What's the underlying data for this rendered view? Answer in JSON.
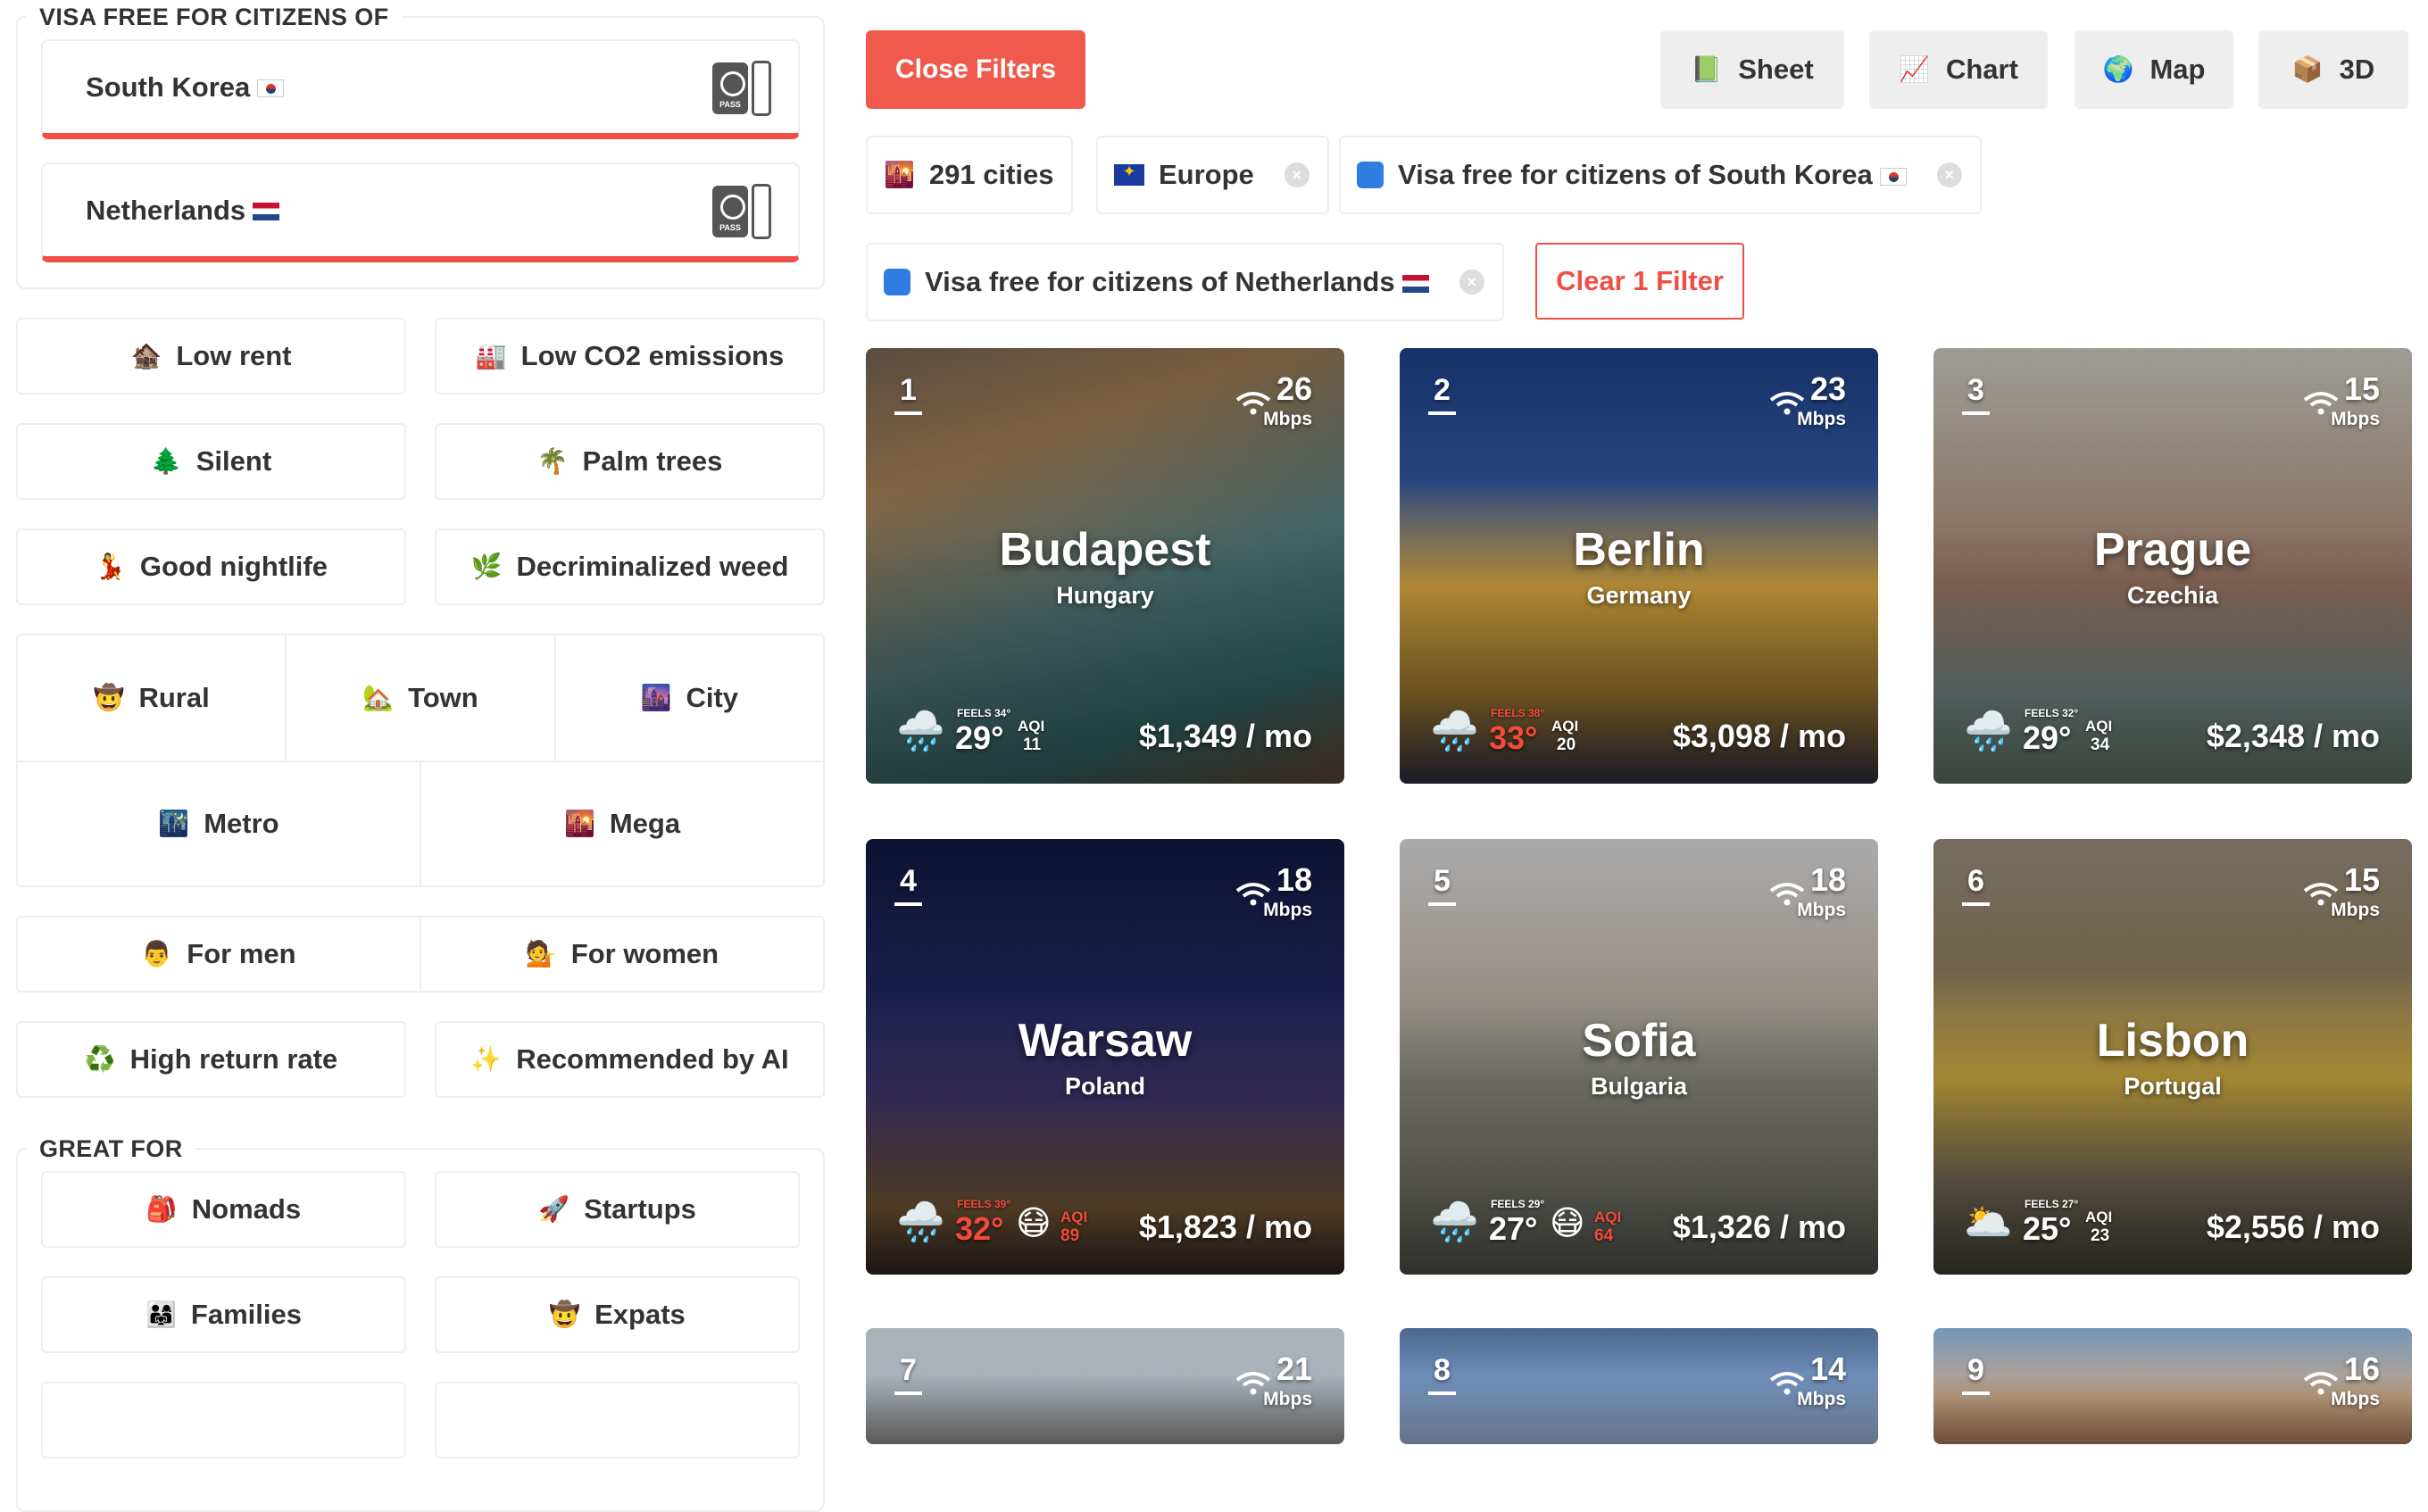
{
  "sidebar": {
    "visa_legend": "VISA FREE FOR CITIZENS OF",
    "visa_countries": [
      {
        "label": "South Korea"
      },
      {
        "label": "Netherlands"
      }
    ],
    "pass_text": "PASS",
    "filters_a": [
      {
        "icon": "🏚️",
        "label": "Low rent"
      },
      {
        "icon": "🏭",
        "label": "Low CO2 emissions"
      },
      {
        "icon": "🌲",
        "label": "Silent"
      },
      {
        "icon": "🌴",
        "label": "Palm trees"
      },
      {
        "icon": "💃",
        "label": "Good nightlife"
      },
      {
        "icon": "🌿",
        "label": "Decriminalized weed"
      }
    ],
    "sizes": [
      {
        "icon": "🤠",
        "label": "Rural"
      },
      {
        "icon": "🏡",
        "label": "Town"
      },
      {
        "icon": "🌆",
        "label": "City"
      },
      {
        "icon": "🌃",
        "label": "Metro"
      },
      {
        "icon": "🌇",
        "label": "Mega"
      }
    ],
    "gender": [
      {
        "icon": "👨",
        "label": "For men"
      },
      {
        "icon": "💁",
        "label": "For women"
      }
    ],
    "filters_b": [
      {
        "icon": "♻️",
        "label": "High return rate"
      },
      {
        "icon": "✨",
        "label": "Recommended by AI"
      }
    ],
    "great_for_legend": "GREAT FOR",
    "great_for": [
      {
        "icon": "🎒",
        "label": "Nomads"
      },
      {
        "icon": "🚀",
        "label": "Startups"
      },
      {
        "icon": "👨‍👩‍👧",
        "label": "Families"
      },
      {
        "icon": "🤠",
        "label": "Expats"
      }
    ]
  },
  "toolbar": {
    "close_filters": "Close Filters",
    "views": [
      {
        "icon": "📗",
        "label": "Sheet"
      },
      {
        "icon": "📈",
        "label": "Chart"
      },
      {
        "icon": "🌍",
        "label": "Map"
      },
      {
        "icon": "📦",
        "label": "3D"
      }
    ]
  },
  "chips": {
    "cities": {
      "icon": "🌇",
      "label": "291 cities"
    },
    "region": {
      "label": "Europe"
    },
    "visa_kr": {
      "label": "Visa free for citizens of South Korea"
    },
    "visa_nl": {
      "label": "Visa free for citizens of Netherlands"
    },
    "clear": "Clear 1 Filter",
    "remove_glyph": "×"
  },
  "cards": [
    {
      "rank": "1",
      "speed": "26",
      "unit": "Mbps",
      "city": "Budapest",
      "country": "Hungary",
      "weather": "🌧️",
      "feels": "FEELS 34°",
      "temp": "29°",
      "aqi_label": "AQI",
      "aqi": "11",
      "price": "$1,349 / mo"
    },
    {
      "rank": "2",
      "speed": "23",
      "unit": "Mbps",
      "city": "Berlin",
      "country": "Germany",
      "weather": "🌧️",
      "feels": "FEELS 38°",
      "temp": "33°",
      "aqi_label": "AQI",
      "aqi": "20",
      "price": "$3,098 / mo"
    },
    {
      "rank": "3",
      "speed": "15",
      "unit": "Mbps",
      "city": "Prague",
      "country": "Czechia",
      "weather": "🌧️",
      "feels": "FEELS 32°",
      "temp": "29°",
      "aqi_label": "AQI",
      "aqi": "34",
      "price": "$2,348 / mo"
    },
    {
      "rank": "4",
      "speed": "18",
      "unit": "Mbps",
      "city": "Warsaw",
      "country": "Poland",
      "weather": "🌧️",
      "feels": "FEELS 39°",
      "temp": "32°",
      "mask": "😷",
      "aqi_label": "AQI",
      "aqi": "89",
      "price": "$1,823 / mo"
    },
    {
      "rank": "5",
      "speed": "18",
      "unit": "Mbps",
      "city": "Sofia",
      "country": "Bulgaria",
      "weather": "🌧️",
      "feels": "FEELS 29°",
      "temp": "27°",
      "mask": "😷",
      "aqi_label": "AQI",
      "aqi": "64",
      "price": "$1,326 / mo"
    },
    {
      "rank": "6",
      "speed": "15",
      "unit": "Mbps",
      "city": "Lisbon",
      "country": "Portugal",
      "weather": "🌥️",
      "feels": "FEELS 27°",
      "temp": "25°",
      "aqi_label": "AQI",
      "aqi": "23",
      "price": "$2,556 / mo"
    },
    {
      "rank": "7",
      "speed": "21",
      "unit": "Mbps"
    },
    {
      "rank": "8",
      "speed": "14",
      "unit": "Mbps"
    },
    {
      "rank": "9",
      "speed": "16",
      "unit": "Mbps"
    }
  ],
  "colors": {
    "accent_red": "#ef5a4c",
    "hot_red": "#f34b3a",
    "border_grey": "#eeeeee"
  }
}
